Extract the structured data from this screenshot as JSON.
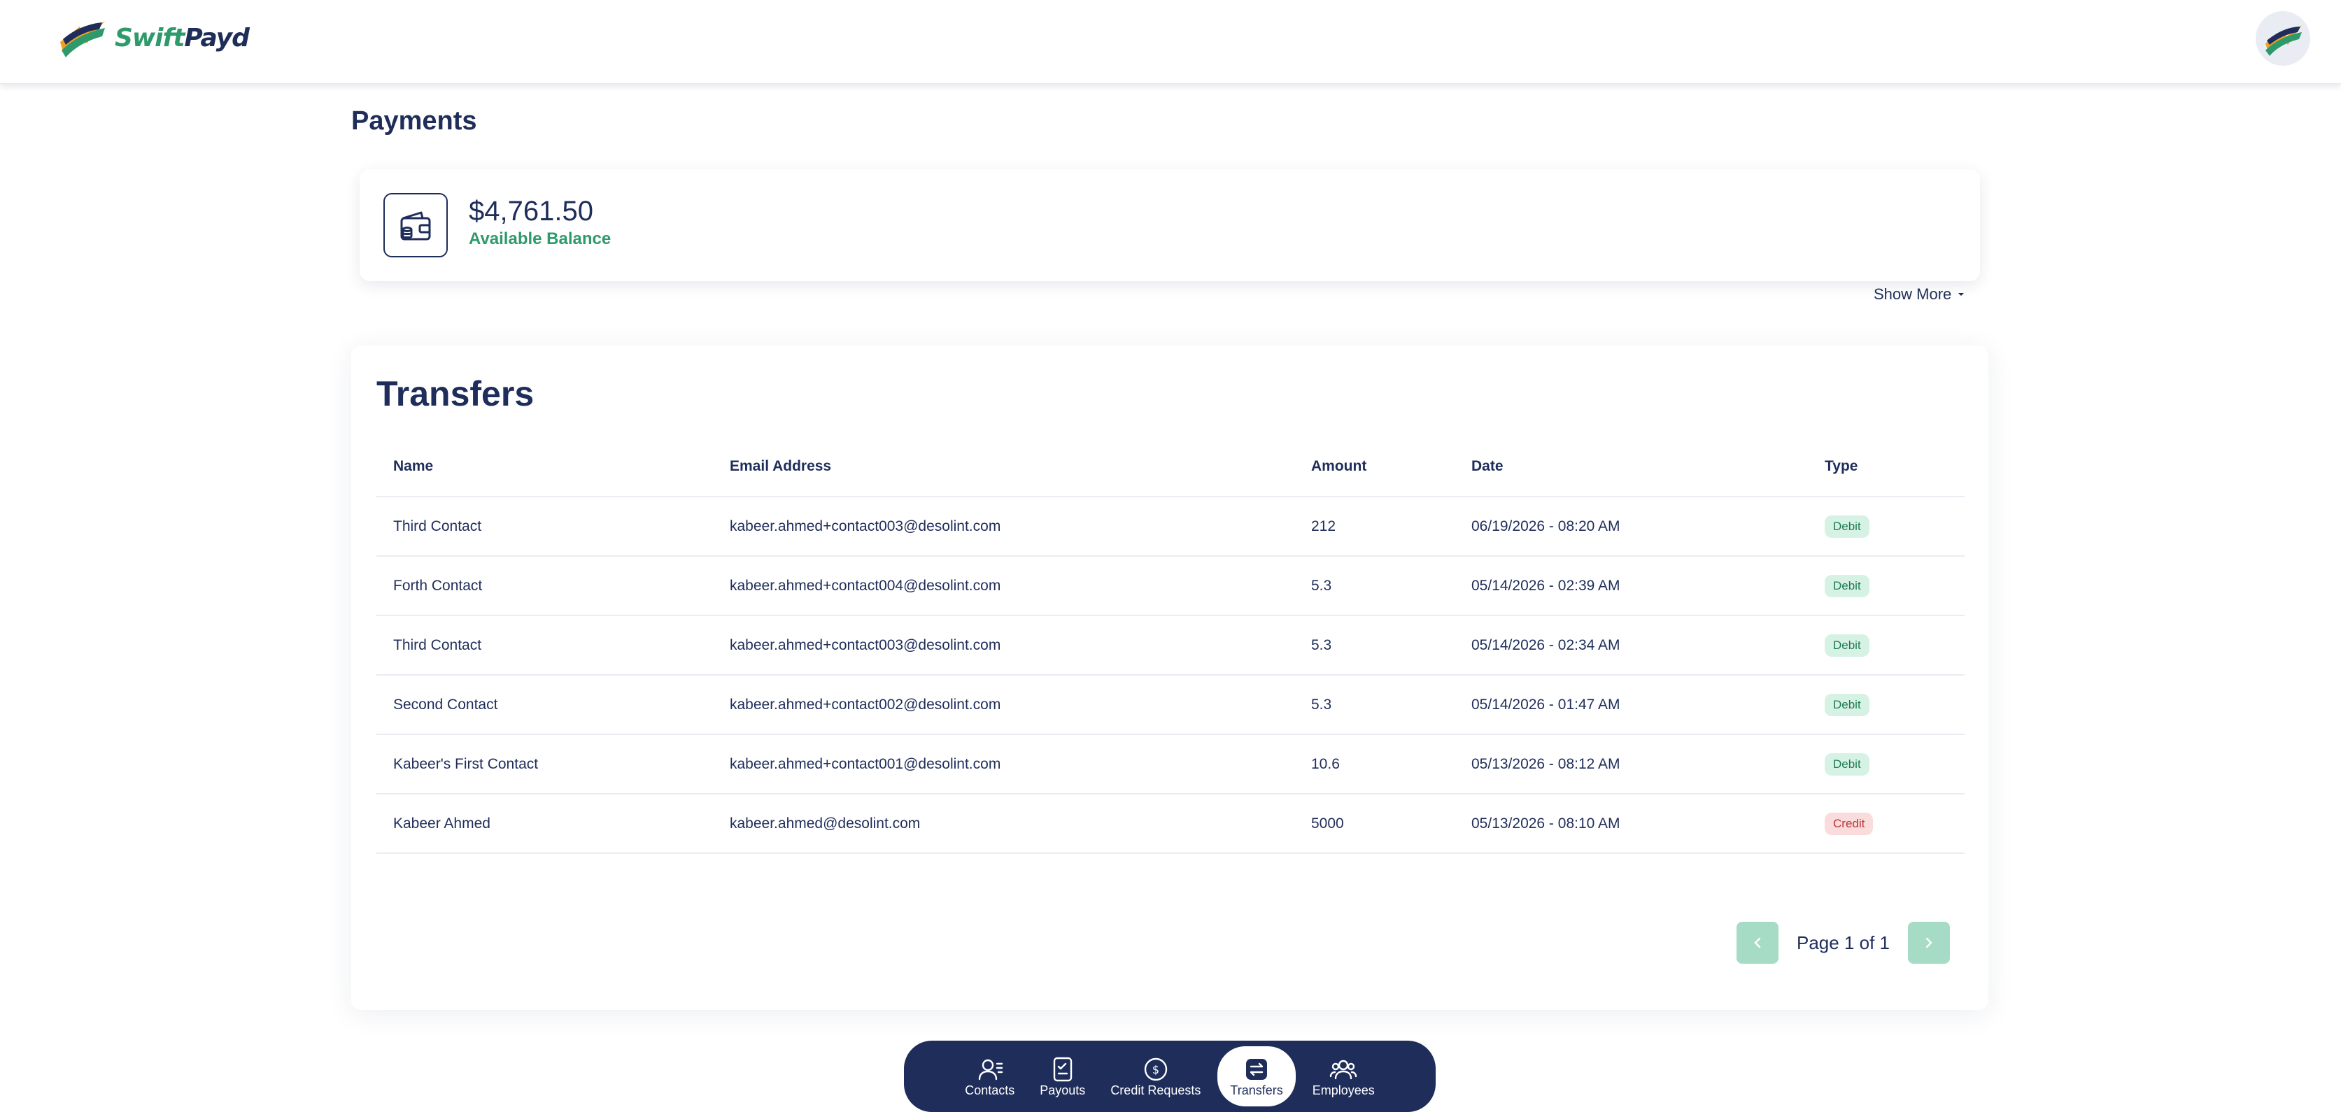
{
  "brand": {
    "name_part1": "Swift",
    "name_part2": "Payd",
    "accent": "#2e9a6b",
    "primary": "#1f2d5a"
  },
  "header": {
    "avatar_icon": "user-avatar-icon"
  },
  "page": {
    "title": "Payments"
  },
  "balance": {
    "amount": "$4,761.50",
    "label": "Available Balance",
    "icon": "wallet-icon",
    "show_more": "Show More"
  },
  "transfers": {
    "title": "Transfers",
    "columns": [
      "Name",
      "Email Address",
      "Amount",
      "Date",
      "Type"
    ],
    "rows": [
      {
        "name": "Third Contact",
        "email": "kabeer.ahmed+contact003@desolint.com",
        "amount": "212",
        "date": "06/19/2026 - 08:20 AM",
        "type": "Debit"
      },
      {
        "name": "Forth Contact",
        "email": "kabeer.ahmed+contact004@desolint.com",
        "amount": "5.3",
        "date": "05/14/2026 - 02:39 AM",
        "type": "Debit"
      },
      {
        "name": "Third Contact",
        "email": "kabeer.ahmed+contact003@desolint.com",
        "amount": "5.3",
        "date": "05/14/2026 - 02:34 AM",
        "type": "Debit"
      },
      {
        "name": "Second Contact",
        "email": "kabeer.ahmed+contact002@desolint.com",
        "amount": "5.3",
        "date": "05/14/2026 - 01:47 AM",
        "type": "Debit"
      },
      {
        "name": "Kabeer's First Contact",
        "email": "kabeer.ahmed+contact001@desolint.com",
        "amount": "10.6",
        "date": "05/13/2026 - 08:12 AM",
        "type": "Debit"
      },
      {
        "name": "Kabeer Ahmed",
        "email": "kabeer.ahmed@desolint.com",
        "amount": "5000",
        "date": "05/13/2026 - 08:10 AM",
        "type": "Credit"
      }
    ],
    "pagination": {
      "text": "Page 1 of 1"
    }
  },
  "bottom_nav": {
    "items": [
      {
        "label": "Contacts",
        "icon": "contacts-icon"
      },
      {
        "label": "Payouts",
        "icon": "payouts-icon"
      },
      {
        "label": "Credit Requests",
        "icon": "dollar-circle-icon"
      },
      {
        "label": "Transfers",
        "icon": "transfer-arrows-icon",
        "active": true
      },
      {
        "label": "Employees",
        "icon": "employees-icon"
      }
    ]
  }
}
